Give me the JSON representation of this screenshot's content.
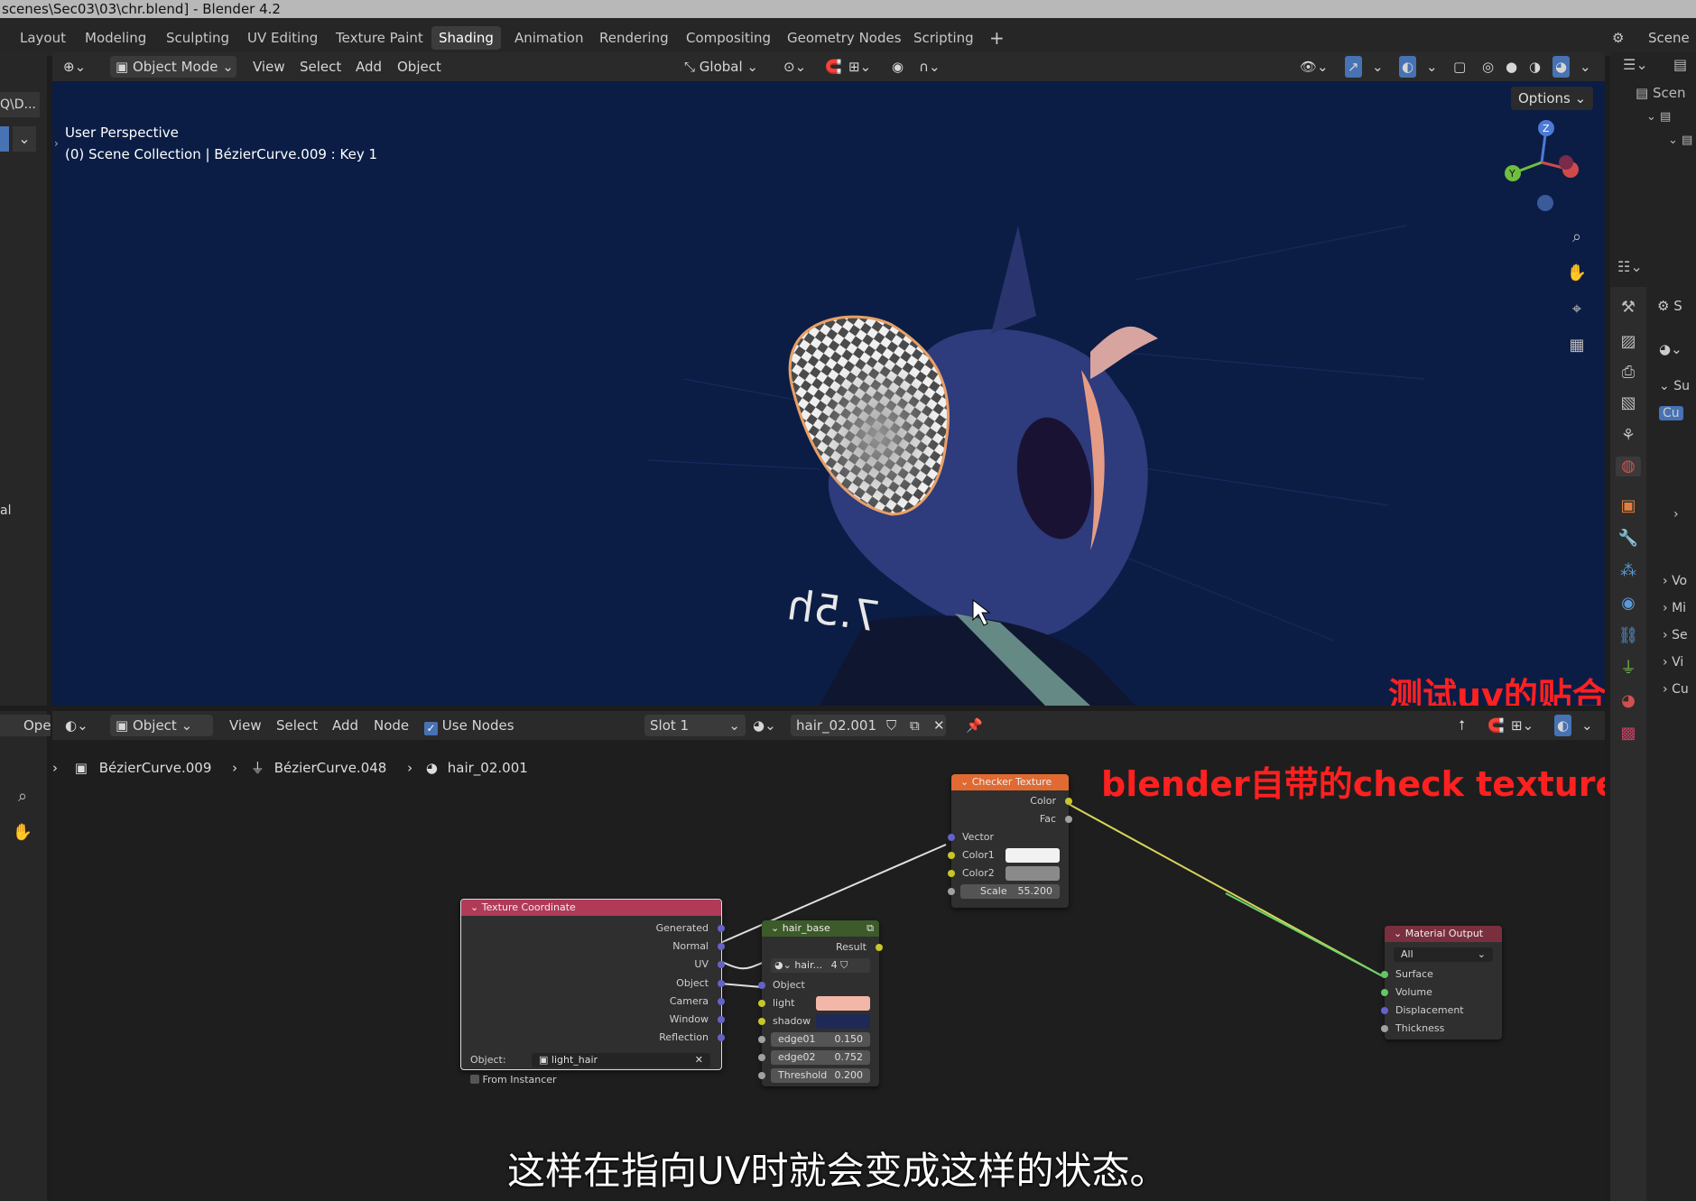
{
  "window": {
    "title": "scenes\\Sec03\\03\\chr.blend] - Blender 4.2"
  },
  "workspace_tabs": [
    {
      "label": "Layout"
    },
    {
      "label": "Modeling"
    },
    {
      "label": "Sculpting"
    },
    {
      "label": "UV Editing"
    },
    {
      "label": "Texture Paint"
    },
    {
      "label": "Shading"
    },
    {
      "label": "Animation"
    },
    {
      "label": "Rendering"
    },
    {
      "label": "Compositing"
    },
    {
      "label": "Geometry Nodes"
    },
    {
      "label": "Scripting"
    }
  ],
  "active_tab": "Shading",
  "scene_label": "Scene",
  "viewport": {
    "mode": "Object Mode",
    "menus": [
      "View",
      "Select",
      "Add",
      "Object"
    ],
    "transform_orientation": "Global",
    "options_label": "Options",
    "overlay_line1": "User Perspective",
    "overlay_line2": "(0) Scene Collection | BézierCurve.009 : Key 1",
    "sign_text": "7.5h",
    "left_fragment": "Q\\D...",
    "left_fragment2": "al"
  },
  "node_editor": {
    "editor_type_label": "Ope",
    "object_dropdown": "Object",
    "menus": [
      "View",
      "Select",
      "Add",
      "Node"
    ],
    "use_nodes_label": "Use Nodes",
    "use_nodes_checked": true,
    "slot_label": "Slot 1",
    "material_name": "hair_02.001",
    "breadcrumb": [
      "BézierCurve.009",
      "BézierCurve.048",
      "hair_02.001"
    ]
  },
  "nodes": {
    "checker": {
      "title": "Checker Texture",
      "outputs": [
        "Color",
        "Fac"
      ],
      "inputs": [
        "Vector",
        "Color1",
        "Color2"
      ],
      "scale_label": "Scale",
      "scale_value": "55.200",
      "color1": "#f2f2f2",
      "color2": "#8a8a8a"
    },
    "texcoord": {
      "title": "Texture Coordinate",
      "outputs": [
        "Generated",
        "Normal",
        "UV",
        "Object",
        "Camera",
        "Window",
        "Reflection"
      ],
      "object_label": "Object:",
      "object_value": "light_hair",
      "from_instancer": "From Instancer"
    },
    "hairbase": {
      "title": "hair_base",
      "result_label": "Result",
      "sub_name": "hair...",
      "sub_count": "4",
      "inputs": [
        "Object",
        "light",
        "shadow"
      ],
      "edge01_label": "edge01",
      "edge01_value": "0.150",
      "edge02_label": "edge02",
      "edge02_value": "0.752",
      "threshold_label": "Threshold",
      "threshold_value": "0.200",
      "light_color": "#f2b7a8",
      "shadow_color": "#1e2a55"
    },
    "matout": {
      "title": "Material Output",
      "target": "All",
      "inputs": [
        "Surface",
        "Volume",
        "Displacement",
        "Thickness"
      ]
    }
  },
  "right_panel": {
    "outliner_label": "Scen",
    "prop_fragments": [
      "S",
      "Su",
      "Cu",
      "Vo",
      "Mi",
      "Se",
      "Vi",
      "Cu"
    ]
  },
  "annotations": {
    "line1": "测试uv的贴合",
    "line2": "blender自带的check texture"
  },
  "subtitle": "这样在指向UV时就会变成这样的状态。",
  "colors": {
    "accent": "#4772b3",
    "node_header_texture": "#e06a32",
    "node_header_input": "#b03a58",
    "node_header_group": "#3c5a2a",
    "node_header_output": "#7a2f3e",
    "annotation_red": "#ff2020"
  }
}
